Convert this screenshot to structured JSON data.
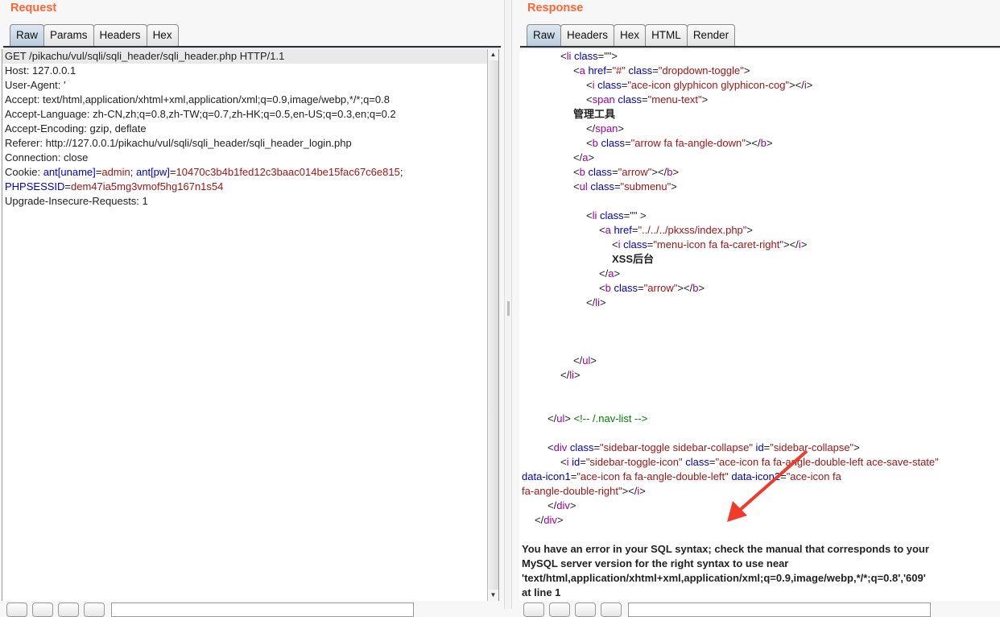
{
  "request": {
    "title": "Request",
    "tabs": [
      "Raw",
      "Params",
      "Headers",
      "Hex"
    ],
    "selected_tab": "Raw",
    "lines": [
      [
        [
          "p",
          "GET /pikachu/vul/sqli/sqli_header/sqli_header.php HTTP/1.1"
        ]
      ],
      [
        [
          "p",
          "Host: 127.0.0.1"
        ]
      ],
      [
        [
          "p",
          "User-Agent: '"
        ]
      ],
      [
        [
          "p",
          "Accept: text/html,application/xhtml+xml,application/xml;q=0.9,image/webp,*/*;q=0.8"
        ]
      ],
      [
        [
          "p",
          "Accept-Language: zh-CN,zh;q=0.8,zh-TW;q=0.7,zh-HK;q=0.5,en-US;q=0.3,en;q=0.2"
        ]
      ],
      [
        [
          "p",
          "Accept-Encoding: gzip, deflate"
        ]
      ],
      [
        [
          "p",
          "Referer: http://127.0.0.1/pikachu/vul/sqli/sqli_header/sqli_header_login.php"
        ]
      ],
      [
        [
          "p",
          "Connection: close"
        ]
      ],
      [
        [
          "p",
          "Cookie: "
        ],
        [
          "a",
          "ant[uname]"
        ],
        [
          "p",
          "="
        ],
        [
          "v",
          "admin"
        ],
        [
          "p",
          "; "
        ],
        [
          "a",
          "ant[pw]"
        ],
        [
          "p",
          "="
        ],
        [
          "v",
          "10470c3b4b1fed12c3baac014be15fac67c6e815"
        ],
        [
          "p",
          ";"
        ]
      ],
      [
        [
          "a",
          "PHPSESSID"
        ],
        [
          "p",
          "="
        ],
        [
          "v",
          "dem47ia5mg3vmof5hg167n1s54"
        ]
      ],
      [
        [
          "p",
          "Upgrade-Insecure-Requests: 1"
        ]
      ]
    ]
  },
  "response": {
    "title": "Response",
    "tabs": [
      "Raw",
      "Headers",
      "Hex",
      "HTML",
      "Render"
    ],
    "selected_tab": "Raw",
    "lines": [
      [
        [
          "p",
          "\t\t\t<"
        ],
        [
          "t",
          "li"
        ],
        [
          "a",
          " class"
        ],
        [
          "p",
          "=\"\">"
        ]
      ],
      [
        [
          "p",
          "\t\t\t\t<"
        ],
        [
          "t",
          "a"
        ],
        [
          "a",
          " href"
        ],
        [
          "p",
          "="
        ],
        [
          "v",
          "\"#\""
        ],
        [
          "a",
          " class"
        ],
        [
          "p",
          "="
        ],
        [
          "v",
          "\"dropdown-toggle\""
        ],
        [
          "p",
          ">"
        ]
      ],
      [
        [
          "p",
          "\t\t\t\t\t<"
        ],
        [
          "t",
          "i"
        ],
        [
          "a",
          " class"
        ],
        [
          "p",
          "="
        ],
        [
          "v",
          "\"ace-icon glyphicon glyphicon-cog\""
        ],
        [
          "p",
          "></"
        ],
        [
          "t",
          "i"
        ],
        [
          "p",
          ">"
        ]
      ],
      [
        [
          "p",
          "\t\t\t\t\t<"
        ],
        [
          "t",
          "span"
        ],
        [
          "a",
          " class"
        ],
        [
          "p",
          "="
        ],
        [
          "v",
          "\"menu-text\""
        ],
        [
          "p",
          ">"
        ]
      ],
      [
        [
          "b",
          "\t\t\t\t管理工具"
        ]
      ],
      [
        [
          "p",
          "\t\t\t\t\t</"
        ],
        [
          "t",
          "span"
        ],
        [
          "p",
          ">"
        ]
      ],
      [
        [
          "p",
          "\t\t\t\t\t<"
        ],
        [
          "t",
          "b"
        ],
        [
          "a",
          " class"
        ],
        [
          "p",
          "="
        ],
        [
          "v",
          "\"arrow fa fa-angle-down\""
        ],
        [
          "p",
          "></"
        ],
        [
          "t",
          "b"
        ],
        [
          "p",
          ">"
        ]
      ],
      [
        [
          "p",
          "\t\t\t\t</"
        ],
        [
          "t",
          "a"
        ],
        [
          "p",
          ">"
        ]
      ],
      [
        [
          "p",
          "\t\t\t\t<"
        ],
        [
          "t",
          "b"
        ],
        [
          "a",
          " class"
        ],
        [
          "p",
          "="
        ],
        [
          "v",
          "\"arrow\""
        ],
        [
          "p",
          "></"
        ],
        [
          "t",
          "b"
        ],
        [
          "p",
          ">"
        ]
      ],
      [
        [
          "p",
          "\t\t\t\t<"
        ],
        [
          "t",
          "ul"
        ],
        [
          "a",
          " class"
        ],
        [
          "p",
          "="
        ],
        [
          "v",
          "\"submenu\""
        ],
        [
          "p",
          ">"
        ]
      ],
      [],
      [
        [
          "p",
          "\t\t\t\t\t<"
        ],
        [
          "t",
          "li"
        ],
        [
          "a",
          " class"
        ],
        [
          "p",
          "=\"\" >"
        ]
      ],
      [
        [
          "p",
          "\t\t\t\t\t\t<"
        ],
        [
          "t",
          "a"
        ],
        [
          "a",
          " href"
        ],
        [
          "p",
          "="
        ],
        [
          "v",
          "\"../../../pkxss/index.php\""
        ],
        [
          "p",
          ">"
        ]
      ],
      [
        [
          "p",
          "\t\t\t\t\t\t\t<"
        ],
        [
          "t",
          "i"
        ],
        [
          "a",
          " class"
        ],
        [
          "p",
          "="
        ],
        [
          "v",
          "\"menu-icon fa fa-caret-right\""
        ],
        [
          "p",
          "></"
        ],
        [
          "t",
          "i"
        ],
        [
          "p",
          ">"
        ]
      ],
      [
        [
          "b",
          "\t\t\t\t\t\t\tXSS后台"
        ]
      ],
      [
        [
          "p",
          "\t\t\t\t\t\t</"
        ],
        [
          "t",
          "a"
        ],
        [
          "p",
          ">"
        ]
      ],
      [
        [
          "p",
          "\t\t\t\t\t\t<"
        ],
        [
          "t",
          "b"
        ],
        [
          "a",
          " class"
        ],
        [
          "p",
          "="
        ],
        [
          "v",
          "\"arrow\""
        ],
        [
          "p",
          "></"
        ],
        [
          "t",
          "b"
        ],
        [
          "p",
          ">"
        ]
      ],
      [
        [
          "p",
          "\t\t\t\t\t</"
        ],
        [
          "t",
          "li"
        ],
        [
          "p",
          ">"
        ]
      ],
      [],
      [],
      [],
      [
        [
          "p",
          "\t\t\t\t</"
        ],
        [
          "t",
          "ul"
        ],
        [
          "p",
          ">"
        ]
      ],
      [
        [
          "p",
          "\t\t\t</"
        ],
        [
          "t",
          "li"
        ],
        [
          "p",
          ">"
        ]
      ],
      [],
      [],
      [
        [
          "p",
          "\t\t</"
        ],
        [
          "t",
          "ul"
        ],
        [
          "p",
          "> "
        ],
        [
          "c",
          "<!-- /.nav-list -->"
        ]
      ],
      [],
      [
        [
          "p",
          "\t\t<"
        ],
        [
          "t",
          "div"
        ],
        [
          "a",
          " class"
        ],
        [
          "p",
          "="
        ],
        [
          "v",
          "\"sidebar-toggle sidebar-collapse\""
        ],
        [
          "a",
          " id"
        ],
        [
          "p",
          "="
        ],
        [
          "v",
          "\"sidebar-collapse\""
        ],
        [
          "p",
          ">"
        ]
      ],
      [
        [
          "p",
          "\t\t\t<"
        ],
        [
          "t",
          "i"
        ],
        [
          "a",
          " id"
        ],
        [
          "p",
          "="
        ],
        [
          "v",
          "\"sidebar-toggle-icon\""
        ],
        [
          "a",
          " class"
        ],
        [
          "p",
          "="
        ],
        [
          "v",
          "\"ace-icon fa fa-angle-double-left ace-save-state\""
        ]
      ],
      [
        [
          "a",
          "data-icon1"
        ],
        [
          "p",
          "="
        ],
        [
          "v",
          "\"ace-icon fa fa-angle-double-left\""
        ],
        [
          "a",
          " data-icon2"
        ],
        [
          "p",
          "="
        ],
        [
          "v",
          "\"ace-icon fa"
        ]
      ],
      [
        [
          "v",
          "fa-angle-double-right\""
        ],
        [
          "p",
          "></"
        ],
        [
          "t",
          "i"
        ],
        [
          "p",
          ">"
        ]
      ],
      [
        [
          "p",
          "\t\t</"
        ],
        [
          "t",
          "div"
        ],
        [
          "p",
          ">"
        ]
      ],
      [
        [
          "p",
          "\t</"
        ],
        [
          "t",
          "div"
        ],
        [
          "p",
          ">"
        ]
      ],
      [],
      [
        [
          "b",
          "You have an error in your SQL syntax; check the manual that corresponds to your"
        ]
      ],
      [
        [
          "b",
          "MySQL server version for the right syntax to use near"
        ]
      ],
      [
        [
          "b",
          "'text/html,application/xhtml+xml,application/xml;q=0.9,image/webp,*/*;q=0.8','609'"
        ]
      ],
      [
        [
          "b",
          "at line 1"
        ]
      ]
    ]
  },
  "annotation": {
    "type": "red-arrow",
    "color": "#f03a2a"
  },
  "colors": {
    "title": "#ff6633",
    "tag": "#a000a0",
    "attr": "#0000c8",
    "value": "#a31515",
    "comment": "#008000"
  }
}
